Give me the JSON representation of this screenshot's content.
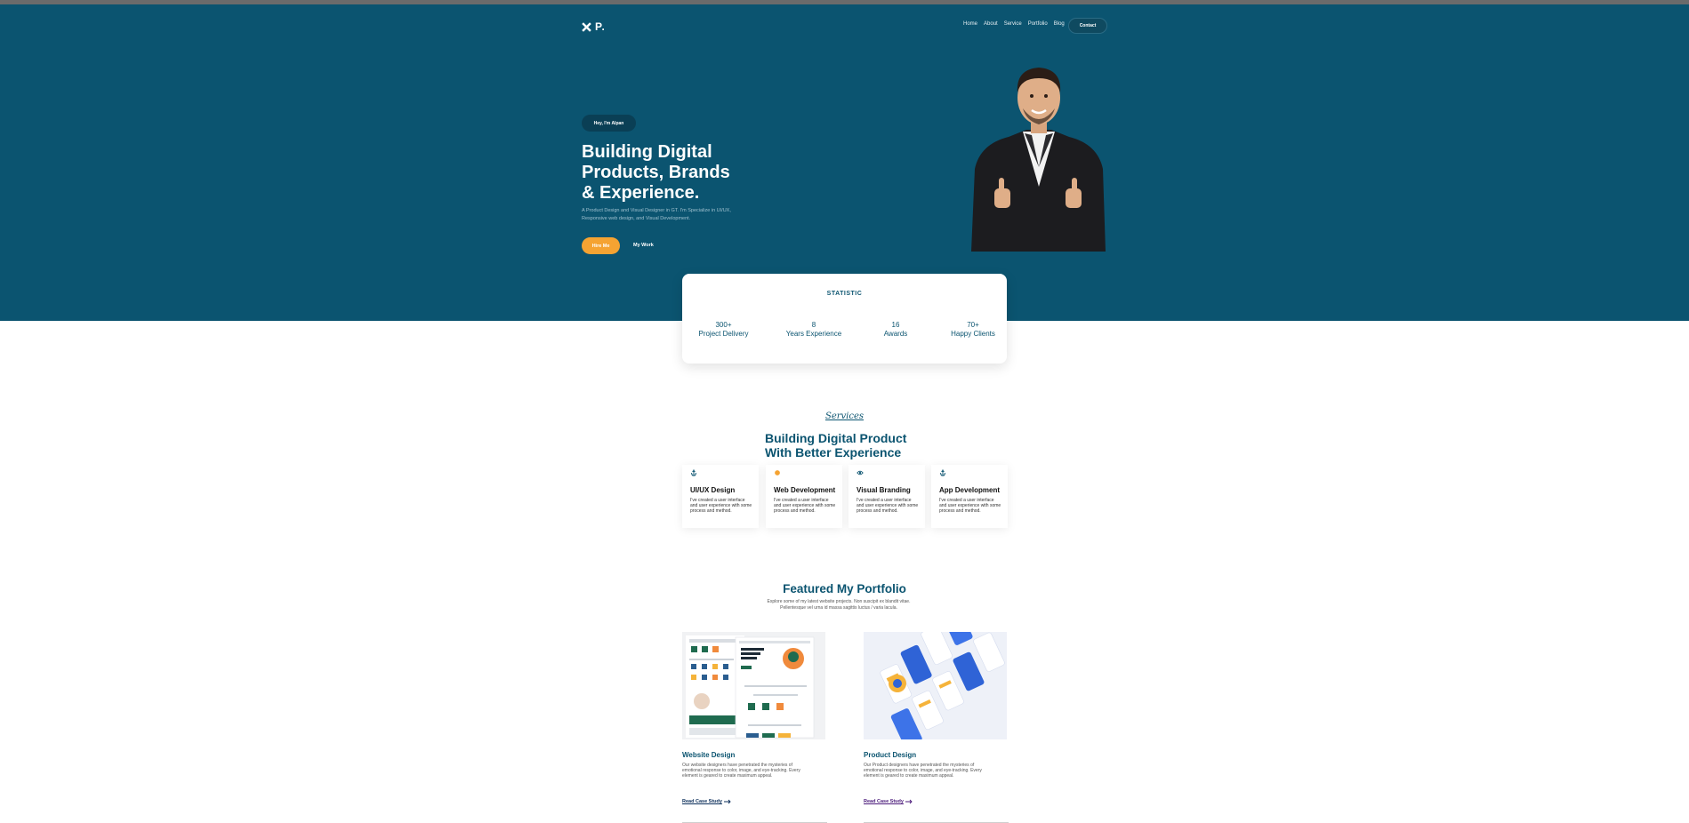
{
  "brand": {
    "logo_text": "P."
  },
  "nav": {
    "items": [
      "Home",
      "About",
      "Service",
      "Portfolio",
      "Blog"
    ],
    "contact_label": "Contact"
  },
  "hero": {
    "pill": "Hey, I'm Alpan",
    "title_line1": "Building Digital",
    "title_line2": "Products, Brands",
    "title_line3": "& Experience.",
    "subtitle": "A Product Design and Visual Designer in GT. I'm Specialize in UI/UX, Responsive web design, and Visual Development.",
    "hire_label": "Hire Me",
    "work_label": "My Work"
  },
  "statistic": {
    "title": "STATISTIC",
    "items": [
      {
        "value": "300+",
        "label": "Project Delivery"
      },
      {
        "value": "8",
        "label": "Years Experience"
      },
      {
        "value": "16",
        "label": "Awards"
      },
      {
        "value": "70+",
        "label": "Happy Clients"
      }
    ]
  },
  "services": {
    "label": "Services",
    "title": "Building Digital Product With Better Experience",
    "items": [
      {
        "name": "UI/UX Design",
        "desc": "I've created a user interface and user experience with some process and method.",
        "icon": "anchor-icon"
      },
      {
        "name": "Web Development",
        "desc": "I've created a user interface and user experience with some process and method.",
        "icon": "sun-icon"
      },
      {
        "name": "Visual Branding",
        "desc": "I've created a user interface and user experience with some process and method.",
        "icon": "eye-icon"
      },
      {
        "name": "App Development",
        "desc": "I've created a user interface and user experience with some process and method.",
        "icon": "anchor-icon"
      }
    ]
  },
  "portfolio": {
    "title": "Featured My Portfolio",
    "subtitle": "Explore some of my latest website projects. Non suscipit ex blandit vitae. Pellentesque vel urna id massa sagittis luctus / varia lacula.",
    "items": [
      {
        "name": "Website Design",
        "desc": "Our website designers have penetrated the mysteries of emotional response to color, image, and eye-tracking. Every element is geared to create maximum appeal.",
        "link": "Read Case Study"
      },
      {
        "name": "Product Design",
        "desc": "Our Product designers have penetrated the mysteries of emotional response to color, image, and eye-tracking. Every element is geared to create maximum appeal.",
        "link": "Read Case Study"
      }
    ]
  },
  "colors": {
    "primary": "#0b5470",
    "accent": "#f5a332"
  }
}
